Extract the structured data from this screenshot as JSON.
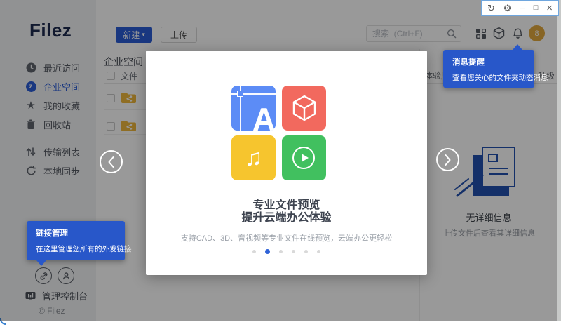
{
  "window": {
    "controls": [
      {
        "name": "refresh",
        "glyph": "↻"
      },
      {
        "name": "settings",
        "glyph": "⚙"
      },
      {
        "name": "minimize",
        "glyph": "−"
      },
      {
        "name": "maximize",
        "glyph": "□"
      },
      {
        "name": "close",
        "glyph": "×"
      }
    ]
  },
  "sidebar": {
    "logo": "Filez",
    "items": [
      {
        "icon": "clock-icon",
        "label": "最近访问"
      },
      {
        "icon": "enterprise-z-icon",
        "label": "企业空间",
        "active": true
      },
      {
        "icon": "star-icon",
        "label": "我的收藏"
      },
      {
        "icon": "trash-icon",
        "label": "回收站"
      },
      {
        "icon": "transfer-icon",
        "label": "传输列表"
      },
      {
        "icon": "sync-icon",
        "label": "本地同步"
      }
    ],
    "badge_letter": "z",
    "star_glyph": "★",
    "console_label": "管理控制台",
    "copyright": "© Filez"
  },
  "toolbar": {
    "new_button": "新建",
    "new_caret": "▾",
    "upload_button": "上传",
    "search_placeholder": "搜索  (Ctrl+F)"
  },
  "breadcrumb": "企业空间",
  "file_list": {
    "column_file": "文件"
  },
  "details_panel": {
    "trial_text": "体验版",
    "upgrade_text": "升级",
    "empty_title": "无详细信息",
    "empty_hint": "上传文件后查看其详细信息"
  },
  "avatar": {
    "label": "8"
  },
  "modal": {
    "title_line1": "专业文件预览",
    "title_line2": "提升云端办公体验",
    "subtitle": "支持CAD、3D、音视频等专业文件在线预览，云端办公更轻松",
    "dots_total": 6,
    "active_dot": 2,
    "tiles": [
      {
        "name": "cad-tile",
        "color": "#5C8CF6",
        "glyph": "A"
      },
      {
        "name": "3d-cube-tile",
        "color": "#F2695E",
        "glyph": "cube"
      },
      {
        "name": "audio-tile",
        "color": "#F6C52E",
        "glyph": "♫"
      },
      {
        "name": "video-tile",
        "color": "#41C05F",
        "glyph": "play"
      }
    ],
    "cad_letter": "A",
    "note_glyph": "♫"
  },
  "tooltips": {
    "message": {
      "title": "消息提醒",
      "body": "查看您关心的文件夹动态消息"
    },
    "link": {
      "title": "链接管理",
      "body": "在这里管理您所有的外发链接"
    }
  },
  "colors": {
    "brand_blue": "#2A5CD5",
    "tooltip_blue": "#2857C9",
    "avatar_gold": "#E2A93E",
    "folder_yellow": "#EFB73D",
    "illustration_blue": "#2250AF"
  }
}
